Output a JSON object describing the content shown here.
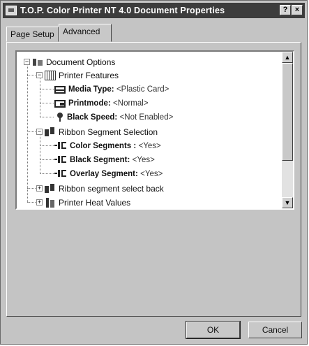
{
  "window": {
    "title": "T.O.P. Color  Printer NT 4.0 Document Properties",
    "help_label": "?",
    "close_label": "×"
  },
  "tabs": [
    {
      "label": "Page Setup",
      "active": false
    },
    {
      "label": "Advanced",
      "active": true
    }
  ],
  "tree": {
    "document_options": {
      "label": "Document Options",
      "expander": "−"
    },
    "printer_features": {
      "label": "Printer Features",
      "expander": "−"
    },
    "media_type": {
      "label": "Media Type:",
      "value": "<Plastic Card>"
    },
    "printmode": {
      "label": "Printmode:",
      "value": "<Normal>"
    },
    "black_speed": {
      "label": "Black Speed:",
      "value": "<Not Enabled>"
    },
    "ribbon_segment_selection": {
      "label": "Ribbon Segment Selection",
      "expander": "−"
    },
    "color_segments": {
      "label": "Color Segments :",
      "value": "<Yes>"
    },
    "black_segment": {
      "label": "Black Segment:",
      "value": "<Yes>"
    },
    "overlay_segment": {
      "label": "Overlay Segment:",
      "value": "<Yes>"
    },
    "ribbon_select_back": {
      "label": "Ribbon segment select back",
      "expander": "+"
    },
    "printer_heat_values": {
      "label": "Printer Heat Values",
      "expander": "+"
    }
  },
  "scrollbar": {
    "up_icon": "▲",
    "down_icon": "▼"
  },
  "buttons": {
    "ok": "OK",
    "cancel": "Cancel"
  },
  "colors": {
    "title_bar": "#3c3c3c",
    "dialog_face": "#c4c4c4",
    "tree_background": "#ffffff"
  }
}
